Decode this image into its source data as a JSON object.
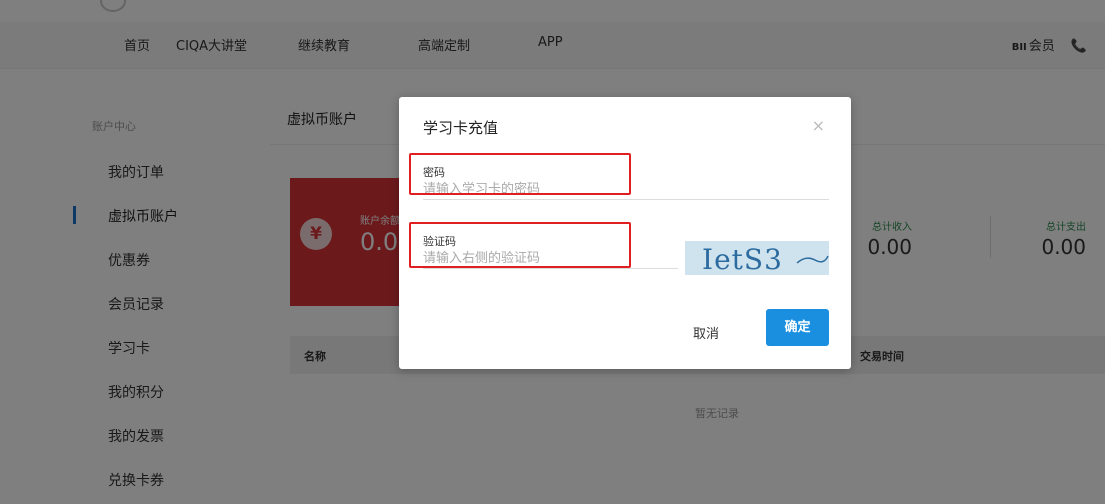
{
  "nav": {
    "items": [
      "首页",
      "CIQA大讲堂",
      "继续教育",
      "高端定制",
      "APP"
    ],
    "vip_mark": "BII",
    "member": "会员",
    "phone_glyph": "📞"
  },
  "sidebar": {
    "title": "账户中心",
    "items": [
      "我的订单",
      "虚拟币账户",
      "优惠券",
      "会员记录",
      "学习卡",
      "我的积分",
      "我的发票",
      "兑换卡券"
    ],
    "active_index": 1
  },
  "account": {
    "title": "虚拟币账户",
    "balance_label": "账户余额",
    "balance_value": "0.00",
    "coin_icon": "¥",
    "income_label": "总计收入",
    "income_value": "0.00",
    "expense_label": "总计支出",
    "expense_value": "0.00",
    "table_headers": [
      "名称",
      "交易时间"
    ],
    "empty_text": "暂无记录"
  },
  "modal": {
    "title": "学习卡充值",
    "close_icon": "×",
    "password_label": "密码",
    "password_placeholder": "请输入学习卡的密码",
    "captcha_label": "验证码",
    "captcha_placeholder": "请输入右侧的验证码",
    "captcha_text": "IetS3",
    "cancel_label": "取消",
    "confirm_label": "确定"
  },
  "colors": {
    "accent": "#1a8fe0",
    "card": "#d83338",
    "highlight": "#e02020"
  }
}
